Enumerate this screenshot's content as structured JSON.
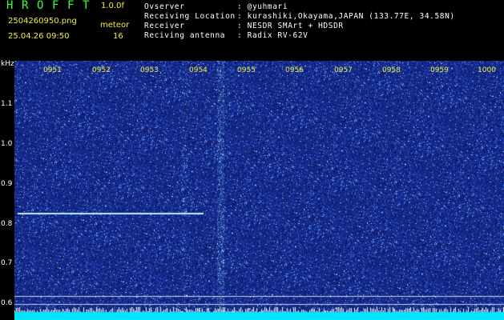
{
  "header": {
    "title_letters": [
      "H",
      "R",
      "O",
      "F",
      "F",
      "T"
    ],
    "version": "1.0.0f",
    "filename": "2504260950.png",
    "datetime": "25.04.26 09:50",
    "meteor_label": "meteor",
    "meteor_count": "16",
    "info_labels": [
      "Ovserver",
      "Receiving Location",
      "Receiver",
      "Reciving antenna"
    ],
    "info_values": [
      ": @yuhmari",
      ": kurashiki,Okayama,JAPAN (133.77E, 34.58N)",
      ": NESDR SMArt + HDSDR",
      ": Radix RV-62V"
    ]
  },
  "axis": {
    "unit": "kHz",
    "y_labels": [
      "1.1",
      "1.0",
      "0.9",
      "0.8",
      "0.7",
      "0.6"
    ],
    "time_labels": [
      "0951",
      "0952",
      "0953",
      "0954",
      "0955",
      "0956",
      "0957",
      "0958",
      "0959",
      "1000"
    ]
  },
  "colors": {
    "title": "#3cff3c",
    "header_text": "#f2ef4a",
    "info_text": "#ffffff",
    "background": "#000000",
    "spectrogram_bg": "#0b1d8a",
    "meteor_trace": "#b9f0ff",
    "baseline": "#00e5ff"
  }
}
